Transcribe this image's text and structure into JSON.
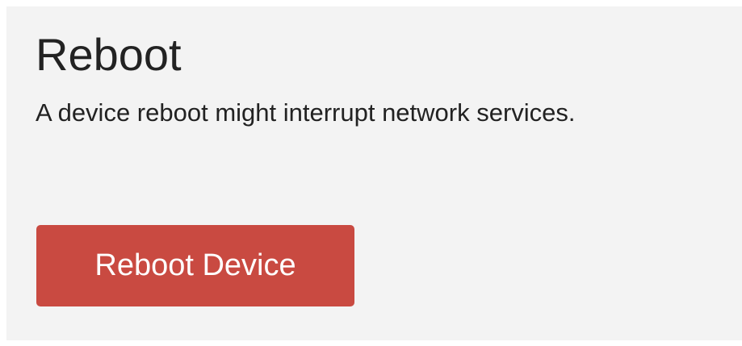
{
  "section": {
    "title": "Reboot",
    "description": "A device reboot might interrupt network services.",
    "button_label": "Reboot Device"
  },
  "colors": {
    "background": "#f3f3f3",
    "button": "#c94a41",
    "text": "#222222"
  }
}
